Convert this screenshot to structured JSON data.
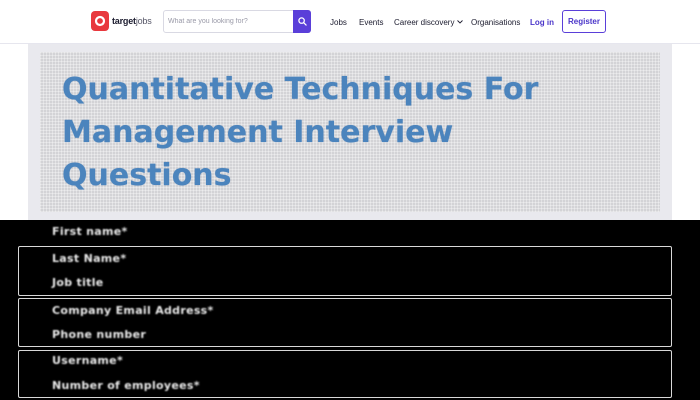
{
  "header": {
    "logo_text_bold": "target",
    "logo_text_light": "jobs",
    "search_placeholder": "What are you looking for?",
    "nav": {
      "jobs": "Jobs",
      "events": "Events",
      "career_discovery": "Career discovery",
      "organisations": "Organisations"
    },
    "login": "Log in",
    "register": "Register"
  },
  "article": {
    "banner_title_line1": "Quantitative Techniques For",
    "banner_title_line2": "Management Interview",
    "banner_title_line3": "Questions"
  },
  "form": {
    "first_name": "First name*",
    "last_name": "Last Name*",
    "job_title": "Job title",
    "company_email": "Company Email Address*",
    "phone_number": "Phone number",
    "username": "Username*",
    "number_of_employees": "Number of employees*"
  },
  "colors": {
    "brand_red": "#e8383d",
    "accent_purple": "#5a3fd9",
    "banner_title": "#4b84bd"
  }
}
